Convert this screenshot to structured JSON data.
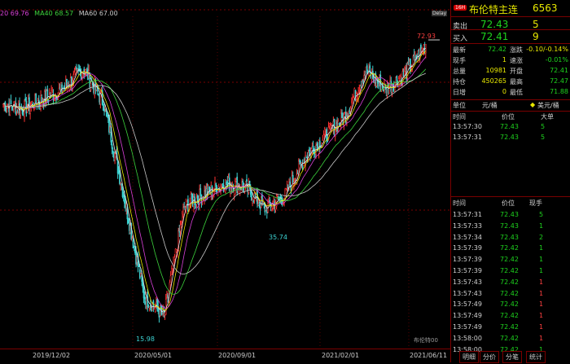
{
  "chart": {
    "ma_labels": [
      {
        "text": "20 69.76",
        "color": "#d940d9"
      },
      {
        "text": "MA40 68.57",
        "color": "#3cd23c"
      },
      {
        "text": "MA60 67.00",
        "color": "#c8c8c8"
      }
    ],
    "delay_label": "Delay",
    "high_label": "72.93",
    "mid_label": "35.74",
    "low_label": "15.98",
    "watermark": "布伦特00",
    "x_ticks": [
      "2019/12/02",
      "2020/05/01",
      "2020/09/01",
      "2021/02/01",
      "2021/06/11"
    ]
  },
  "chart_data": {
    "type": "candlestick",
    "ylim": [
      12,
      78
    ],
    "x": [
      "2019/09",
      "2019/10",
      "2019/11",
      "2019/12/02",
      "2020/01",
      "2020/02",
      "2020/03",
      "2020/04",
      "2020/05/01",
      "2020/06",
      "2020/07",
      "2020/08",
      "2020/09/01",
      "2020/10",
      "2020/11",
      "2020/12",
      "2021/01",
      "2021/02/01",
      "2021/03",
      "2021/04",
      "2021/05",
      "2021/06/11"
    ],
    "close_series": [
      60.5,
      59.5,
      61.5,
      63.5,
      67.5,
      60.5,
      42.0,
      22.0,
      18.0,
      40.0,
      42.5,
      44.5,
      44.0,
      39.5,
      42.0,
      50.0,
      54.0,
      58.0,
      67.0,
      63.5,
      66.5,
      72.4
    ],
    "marked_points": [
      {
        "label": "72.93",
        "value": 72.93
      },
      {
        "label": "35.74",
        "value": 35.74
      },
      {
        "label": "15.98",
        "value": 15.98
      }
    ]
  },
  "panel": {
    "badge": "16H",
    "name": "布伦特主连",
    "code": "6563",
    "sell_label": "卖出",
    "sell_price": "72.43",
    "sell_qty": "5",
    "buy_label": "买入",
    "buy_price": "72.41",
    "buy_qty": "9",
    "stats": [
      {
        "l1": "最新",
        "v1": "72.42",
        "c1": "g",
        "l2": "涨跌",
        "v2": "-0.10/-0.14%",
        "c2": "y"
      },
      {
        "l1": "现手",
        "v1": "1",
        "c1": "y",
        "l2": "速涨",
        "v2": "-0.01%",
        "c2": "g"
      },
      {
        "l1": "总量",
        "v1": "10981",
        "c1": "y",
        "l2": "开盘",
        "v2": "72.41",
        "c2": "g"
      },
      {
        "l1": "持仓",
        "v1": "450265",
        "c1": "y",
        "l2": "最高",
        "v2": "72.47",
        "c2": "g"
      },
      {
        "l1": "日增",
        "v1": "0",
        "c1": "y",
        "l2": "最低",
        "v2": "71.88",
        "c2": "g"
      }
    ],
    "unit_label": "单位",
    "unit_value": "元/桶",
    "currency": "美元/桶",
    "ticks_header": {
      "time": "时间",
      "price": "价位",
      "vol": "大单"
    },
    "big_trades": [
      {
        "time": "13:57:30",
        "price": "72.43",
        "vol": "5"
      },
      {
        "time": "13:57:31",
        "price": "72.43",
        "vol": "5"
      }
    ],
    "ticks2_header": {
      "time": "时间",
      "price": "价位",
      "vol": "现手"
    },
    "trades": [
      {
        "time": "13:57:31",
        "price": "72.43",
        "vol": "5",
        "vc": "g"
      },
      {
        "time": "13:57:33",
        "price": "72.43",
        "vol": "1",
        "vc": "g"
      },
      {
        "time": "13:57:34",
        "price": "72.43",
        "vol": "2",
        "vc": "g"
      },
      {
        "time": "13:57:39",
        "price": "72.42",
        "vol": "1",
        "vc": "g"
      },
      {
        "time": "13:57:39",
        "price": "72.42",
        "vol": "1",
        "vc": "g"
      },
      {
        "time": "13:57:39",
        "price": "72.42",
        "vol": "1",
        "vc": "g"
      },
      {
        "time": "13:57:43",
        "price": "72.42",
        "vol": "1",
        "vc": "r"
      },
      {
        "time": "13:57:43",
        "price": "72.42",
        "vol": "1",
        "vc": "r"
      },
      {
        "time": "13:57:49",
        "price": "72.42",
        "vol": "1",
        "vc": "r"
      },
      {
        "time": "13:57:49",
        "price": "72.42",
        "vol": "1",
        "vc": "r"
      },
      {
        "time": "13:57:49",
        "price": "72.42",
        "vol": "1",
        "vc": "r"
      },
      {
        "time": "13:58:00",
        "price": "72.42",
        "vol": "1",
        "vc": "r"
      },
      {
        "time": "13:58:00",
        "price": "72.42",
        "vol": "1",
        "vc": "g"
      }
    ],
    "tabs": [
      "明细",
      "分价",
      "分笔",
      "统计"
    ]
  }
}
